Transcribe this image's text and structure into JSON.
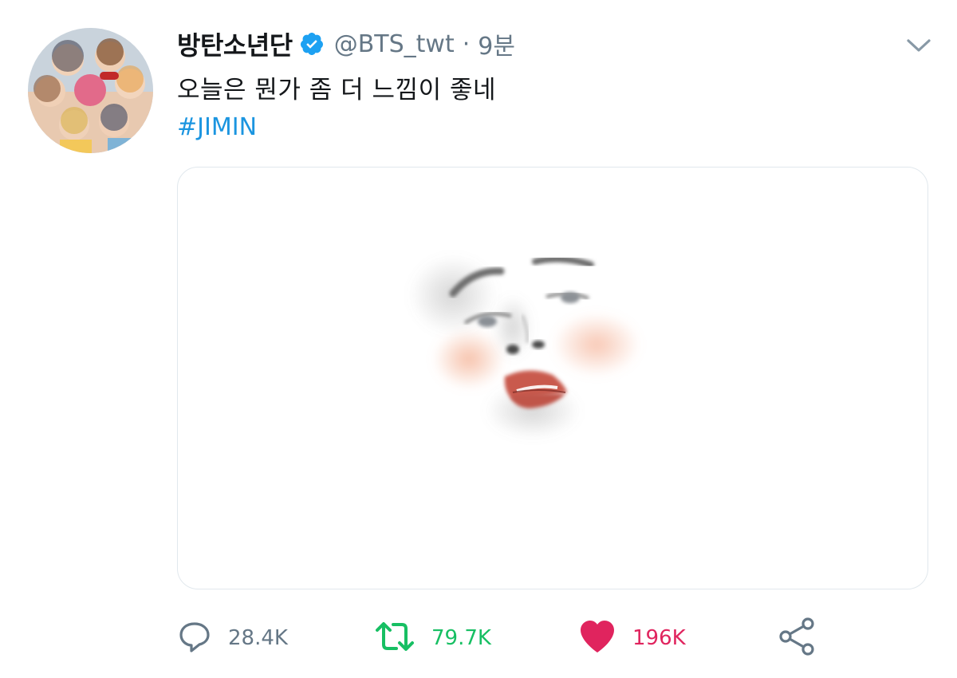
{
  "tweet": {
    "author": {
      "display_name": "방탄소년단",
      "handle": "@BTS_twt",
      "verified_icon": "verified-badge-icon",
      "avatar": "group-photo-avatar"
    },
    "separator": "·",
    "timestamp": "9분",
    "text": "오늘은 뭔가 좀 더 느낌이 좋네",
    "hashtag": "#JIMIN",
    "media": "face-artwork-image",
    "actions": {
      "reply": {
        "icon": "reply-icon",
        "count": "28.4K"
      },
      "retweet": {
        "icon": "retweet-icon",
        "count": "79.7K"
      },
      "like": {
        "icon": "heart-icon",
        "count": "196K"
      },
      "share": {
        "icon": "share-icon"
      }
    },
    "menu_icon": "chevron-down-icon"
  },
  "colors": {
    "verified": "#1da1f2",
    "hashtag": "#1b95e0",
    "secondary_text": "#657786",
    "retweet": "#17bf63",
    "like": "#e0245e"
  }
}
